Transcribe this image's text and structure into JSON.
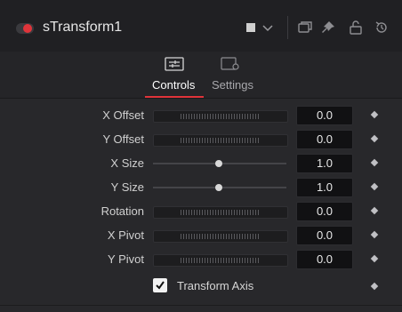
{
  "header": {
    "node_name": "sTransform1",
    "icons": [
      "node-toggle-icon",
      "color-swatch-icon",
      "chevron-down-icon",
      "versions-icon",
      "pin-icon",
      "lock-icon",
      "reset-icon"
    ]
  },
  "tabs": [
    {
      "label": "Controls",
      "icon": "sliders-icon",
      "active": true
    },
    {
      "label": "Settings",
      "icon": "settings-icon",
      "active": false
    }
  ],
  "controls": [
    {
      "label": "X Offset",
      "type": "thumbwheel",
      "value": "0.0"
    },
    {
      "label": "Y Offset",
      "type": "thumbwheel",
      "value": "0.0"
    },
    {
      "label": "X Size",
      "type": "slider",
      "value": "1.0",
      "position": 0.5
    },
    {
      "label": "Y Size",
      "type": "slider",
      "value": "1.0",
      "position": 0.5
    },
    {
      "label": "Rotation",
      "type": "thumbwheel",
      "value": "0.0"
    },
    {
      "label": "X Pivot",
      "type": "thumbwheel",
      "value": "0.0"
    },
    {
      "label": "Y Pivot",
      "type": "thumbwheel",
      "value": "0.0"
    }
  ],
  "checkbox": {
    "label": "Transform Axis",
    "checked": true
  },
  "colors": {
    "accent": "#e0343a",
    "panel": "#28282b",
    "value_bg": "#111113"
  }
}
